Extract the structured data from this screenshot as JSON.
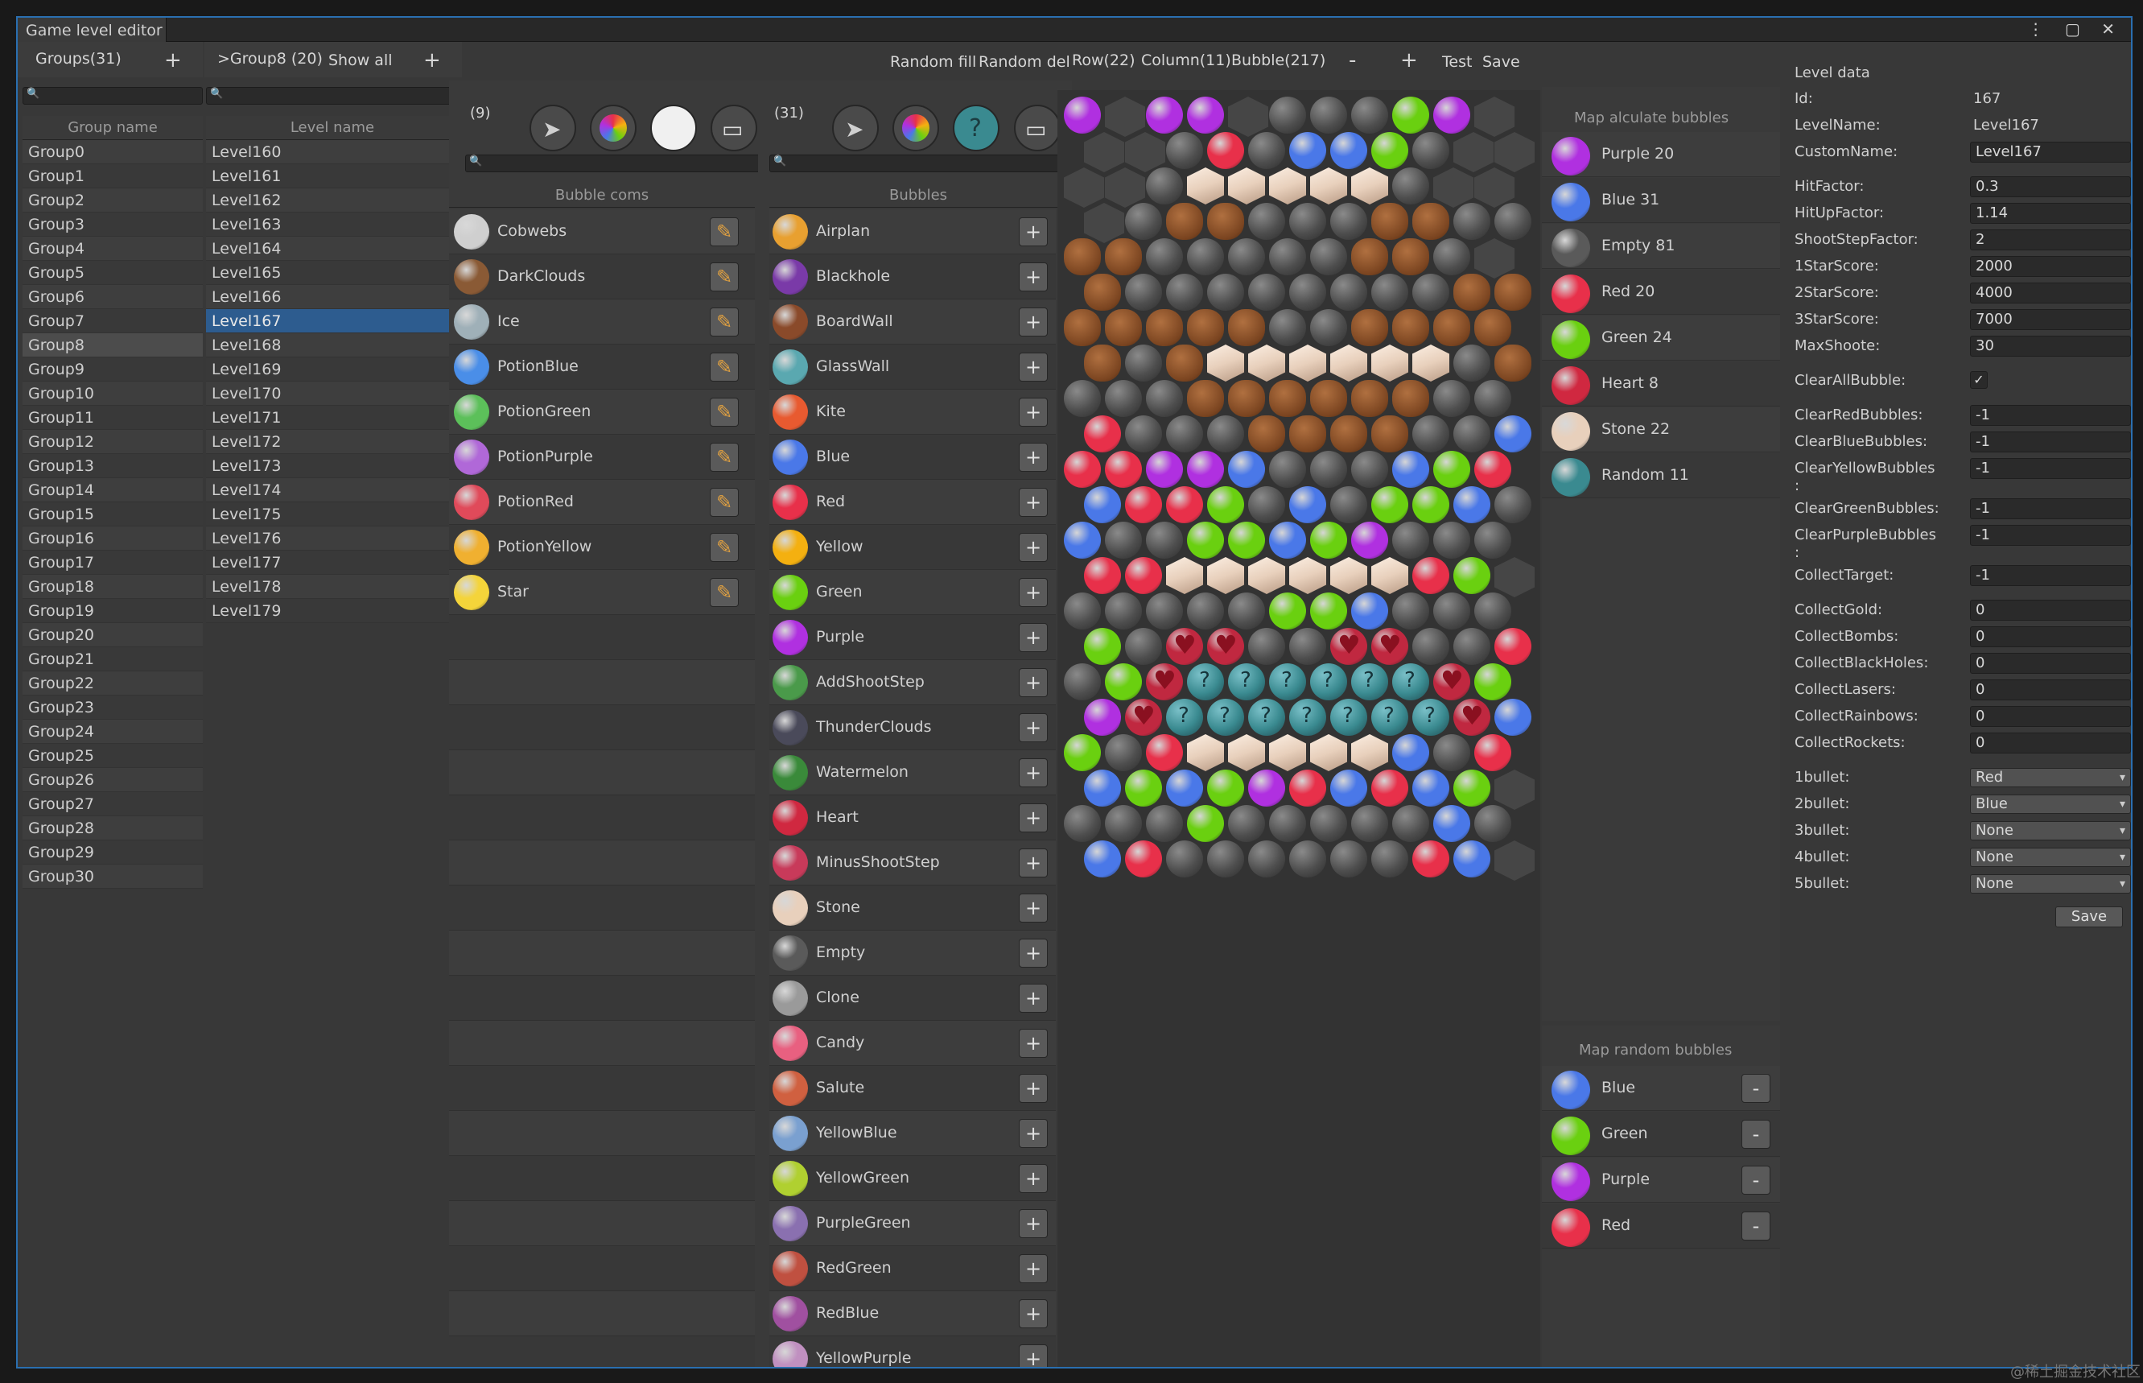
{
  "window": {
    "title": "Game level editor",
    "controls": "⋮ ▢ ✕"
  },
  "groups_panel": {
    "tab_label": "Groups(31)",
    "add": "+",
    "column": "Group name",
    "items": [
      "Group0",
      "Group1",
      "Group2",
      "Group3",
      "Group4",
      "Group5",
      "Group6",
      "Group7",
      "Group8",
      "Group9",
      "Group10",
      "Group11",
      "Group12",
      "Group13",
      "Group14",
      "Group15",
      "Group16",
      "Group17",
      "Group18",
      "Group19",
      "Group20",
      "Group21",
      "Group22",
      "Group23",
      "Group24",
      "Group25",
      "Group26",
      "Group27",
      "Group28",
      "Group29",
      "Group30"
    ],
    "selected": 8
  },
  "levels_panel": {
    "tab_label": ">Group8 (20)",
    "show_all": "Show all",
    "add": "+",
    "column": "Level name",
    "items": [
      "Level160",
      "Level161",
      "Level162",
      "Level163",
      "Level164",
      "Level165",
      "Level166",
      "Level167",
      "Level168",
      "Level169",
      "Level170",
      "Level171",
      "Level172",
      "Level173",
      "Level174",
      "Level175",
      "Level176",
      "Level177",
      "Level178",
      "Level179"
    ],
    "selected": 7
  },
  "bubble_coms": {
    "count": "(9)",
    "header": "Bubble coms",
    "items": [
      {
        "name": "Cobwebs",
        "color": "#cfcfcf"
      },
      {
        "name": "DarkClouds",
        "color": "#8a5a35"
      },
      {
        "name": "Ice",
        "color": "#9fb0b8"
      },
      {
        "name": "PotionBlue",
        "color": "#4a8ee8"
      },
      {
        "name": "PotionGreen",
        "color": "#5cc05a"
      },
      {
        "name": "PotionPurple",
        "color": "#b068d8"
      },
      {
        "name": "PotionRed",
        "color": "#e04a5a"
      },
      {
        "name": "PotionYellow",
        "color": "#f0b030"
      },
      {
        "name": "Star",
        "color": "#f4d43a"
      }
    ]
  },
  "bubbles": {
    "count": "(31)",
    "header": "Bubbles",
    "items": [
      {
        "name": "Airplan",
        "color": "#e8a030"
      },
      {
        "name": "Blackhole",
        "color": "#7a3aa8"
      },
      {
        "name": "BoardWall",
        "color": "#8a4a2a"
      },
      {
        "name": "GlassWall",
        "color": "#5aa8b0"
      },
      {
        "name": "Kite",
        "color": "#e85a30"
      },
      {
        "name": "Blue",
        "color": "#4a78e8"
      },
      {
        "name": "Red",
        "color": "#e8304a"
      },
      {
        "name": "Yellow",
        "color": "#f4b010"
      },
      {
        "name": "Green",
        "color": "#6ad010"
      },
      {
        "name": "Purple",
        "color": "#b030e0"
      },
      {
        "name": "AddShootStep",
        "color": "#4a9a4a"
      },
      {
        "name": "ThunderClouds",
        "color": "#4a4a5a"
      },
      {
        "name": "Watermelon",
        "color": "#3a8a3a"
      },
      {
        "name": "Heart",
        "color": "#d02840"
      },
      {
        "name": "MinusShootStep",
        "color": "#c83a5a"
      },
      {
        "name": "Stone",
        "color": "#e8d0bc"
      },
      {
        "name": "Empty",
        "color": "#5a5a5a"
      },
      {
        "name": "Clone",
        "color": "#9a9a9a"
      },
      {
        "name": "Candy",
        "color": "#e86080"
      },
      {
        "name": "Salute",
        "color": "#d06040"
      },
      {
        "name": "YellowBlue",
        "color": "#7aa0d0"
      },
      {
        "name": "YellowGreen",
        "color": "#b0d030"
      },
      {
        "name": "PurpleGreen",
        "color": "#8a70b0"
      },
      {
        "name": "RedGreen",
        "color": "#c05040"
      },
      {
        "name": "RedBlue",
        "color": "#a050a0"
      },
      {
        "name": "YellowPurple",
        "color": "#c090c0"
      }
    ]
  },
  "toolbar": {
    "random_fill": "Random fill",
    "random_del": "Random del",
    "rows": "Row(22)",
    "columns": "Column(11)",
    "bubble_count": "Bubble(217)",
    "minus": "-",
    "plus": "+",
    "test": "Test",
    "save": "Save"
  },
  "map_calc": {
    "header": "Map alculate bubbles",
    "items": [
      {
        "label": "Purple  20",
        "color": "#b030e0"
      },
      {
        "label": "Blue  31",
        "color": "#4a78e8"
      },
      {
        "label": "Empty  81",
        "color": "#5a5a5a"
      },
      {
        "label": "Red  20",
        "color": "#e8304a"
      },
      {
        "label": "Green  24",
        "color": "#6ad010"
      },
      {
        "label": "Heart  8",
        "color": "#d02840"
      },
      {
        "label": "Stone  22",
        "color": "#e8d0bc"
      },
      {
        "label": "Random  11",
        "color": "#3a8a90"
      }
    ]
  },
  "map_random": {
    "header": "Map random bubbles",
    "remove": "-",
    "items": [
      {
        "label": "Blue",
        "color": "#4a78e8"
      },
      {
        "label": "Green",
        "color": "#6ad010"
      },
      {
        "label": "Purple",
        "color": "#b030e0"
      },
      {
        "label": "Red",
        "color": "#e8304a"
      }
    ]
  },
  "level_data": {
    "title": "Level data",
    "fields": [
      {
        "label": "Id:",
        "value": "167",
        "kind": "text"
      },
      {
        "label": "LevelName:",
        "value": "Level167",
        "kind": "text"
      },
      {
        "label": "CustomName:",
        "value": "Level167",
        "kind": "input"
      },
      {
        "label": "HitFactor:",
        "value": "0.3",
        "kind": "input"
      },
      {
        "label": "HitUpFactor:",
        "value": "1.14",
        "kind": "input"
      },
      {
        "label": "ShootStepFactor:",
        "value": "2",
        "kind": "input"
      },
      {
        "label": "1StarScore:",
        "value": "2000",
        "kind": "input"
      },
      {
        "label": "2StarScore:",
        "value": "4000",
        "kind": "input"
      },
      {
        "label": "3StarScore:",
        "value": "7000",
        "kind": "input"
      },
      {
        "label": "MaxShoote:",
        "value": "30",
        "kind": "input"
      },
      {
        "label": "ClearAllBubble:",
        "value": "✓",
        "kind": "check"
      },
      {
        "label": "ClearRedBubbles:",
        "value": "-1",
        "kind": "input"
      },
      {
        "label": "ClearBlueBubbles:",
        "value": "-1",
        "kind": "input"
      },
      {
        "label": "ClearYellowBubbles\n:",
        "value": "-1",
        "kind": "input"
      },
      {
        "label": "ClearGreenBubbles:",
        "value": "-1",
        "kind": "input"
      },
      {
        "label": "ClearPurpleBubbles\n:",
        "value": "-1",
        "kind": "input"
      },
      {
        "label": "CollectTarget:",
        "value": "-1",
        "kind": "input"
      },
      {
        "label": "CollectGold:",
        "value": "0",
        "kind": "input"
      },
      {
        "label": "CollectBombs:",
        "value": "0",
        "kind": "input"
      },
      {
        "label": "CollectBlackHoles:",
        "value": "0",
        "kind": "input"
      },
      {
        "label": "CollectLasers:",
        "value": "0",
        "kind": "input"
      },
      {
        "label": "CollectRainbows:",
        "value": "0",
        "kind": "input"
      },
      {
        "label": "CollectRockets:",
        "value": "0",
        "kind": "input"
      },
      {
        "label": "1bullet:",
        "value": "Red",
        "kind": "select"
      },
      {
        "label": "2bullet:",
        "value": "Blue",
        "kind": "select"
      },
      {
        "label": "3bullet:",
        "value": "None",
        "kind": "select"
      },
      {
        "label": "4bullet:",
        "value": "None",
        "kind": "select"
      },
      {
        "label": "5bullet:",
        "value": "None",
        "kind": "select"
      }
    ],
    "save": "Save"
  },
  "palette": {
    "P": "#b030e0",
    "B": "#4a78e8",
    "R": "#e8304a",
    "G": "#6ad010",
    "E": "#555555",
    "S": "#e8d0bc",
    "W": "#8a4a20",
    "H": "#c02840",
    "Y": "#e8e8e8",
    "Q": "#3a8a90",
    "K": "#46464a"
  },
  "map_grid": [
    "P.PP.EEEGP.P",
    "..EREBBGE...",
    "..ESSSSSE...",
    ".EWWEEEWWEE.",
    "WWEEEEEWWE..",
    "WEEEEEEEEWW.",
    "WWWWWEEWWWWW",
    "WEWSSSSSSEW.",
    "EEEWWWWWWEEE",
    "REEEWWWWEEB.",
    "RRPPBEEEBGRR",
    "BRRGEBEGGBE.",
    "BEEGGBGPEEEG",
    "RRSSSSSSRG..",
    "EEEEEGGBEEEE",
    "GEHHEEHHEER.",
    "EGHQQQQQQHGE",
    "PHQQQQQQQHB.",
    "GERSSSSSBER",
    "BGBGPRBRBG..",
    "EEEGEEEEEBEE",
    "BREEEEEERB.."
  ],
  "watermark": "@稀土掘金技术社区"
}
